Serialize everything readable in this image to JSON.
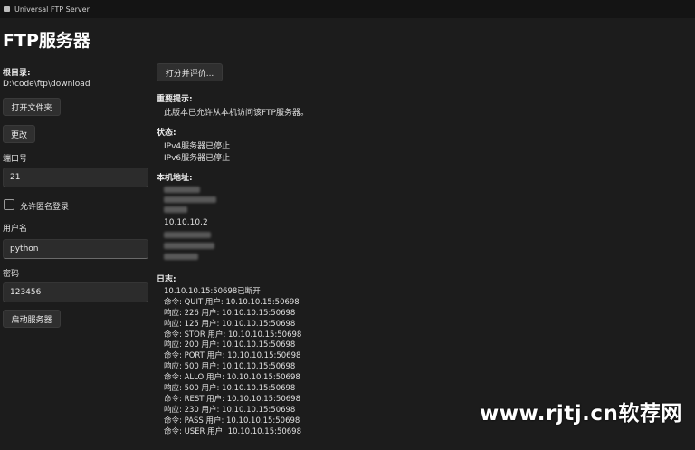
{
  "window": {
    "title": "Universal FTP Server"
  },
  "heading": "FTP服务器",
  "left": {
    "root_label": "根目录:",
    "root_path": "D:\\code\\ftp\\download",
    "open_folder": "打开文件夹",
    "change": "更改",
    "port_label": "端口号",
    "port_value": "21",
    "anonymous_label": "允许匿名登录",
    "anonymous_checked": false,
    "username_label": "用户名",
    "username_value": "python",
    "password_label": "密码",
    "password_value": "123456",
    "start_button": "启动服务器"
  },
  "right": {
    "rate_button": "打分并评价...",
    "notice_label": "重要提示:",
    "notice_text": "此版本已允许从本机访问该FTP服务器。",
    "status_label": "状态:",
    "status_ipv4": "IPv4服务器已停止",
    "status_ipv6": "IPv6服务器已停止",
    "address_label": "本机地址:",
    "address_visible": "10.10.10.2",
    "log_label": "日志:",
    "log": [
      "10.10.10.15:50698已断开",
      "命令: QUIT 用户: 10.10.10.15:50698",
      "响应: 226 用户: 10.10.10.15:50698",
      "响应: 125 用户: 10.10.10.15:50698",
      "命令: STOR 用户: 10.10.10.15:50698",
      "响应: 200 用户: 10.10.10.15:50698",
      "命令: PORT 用户: 10.10.10.15:50698",
      "响应: 500 用户: 10.10.10.15:50698",
      "命令: ALLO 用户: 10.10.10.15:50698",
      "响应: 500 用户: 10.10.10.15:50698",
      "命令: REST 用户: 10.10.10.15:50698",
      "响应: 230 用户: 10.10.10.15:50698",
      "命令: PASS 用户: 10.10.10.15:50698",
      "命令: USER 用户: 10.10.10.15:50698"
    ]
  },
  "watermark": "www.rjtj.cn软荐网",
  "colors": {
    "background": "#1c1c1c",
    "titlebar": "#141414",
    "field": "#2c2c2c",
    "button": "#2f2f2f"
  }
}
